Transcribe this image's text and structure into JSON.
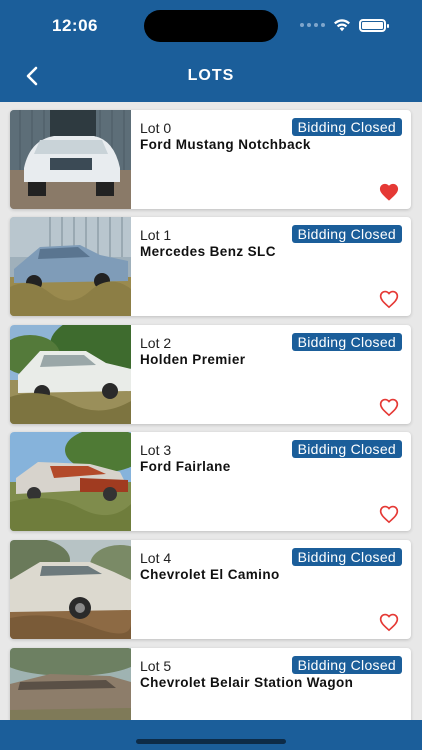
{
  "status_bar": {
    "time": "12:06"
  },
  "nav": {
    "title": "LOTS",
    "back_icon": "chevron-left-icon"
  },
  "colors": {
    "brand": "#1b5e9a",
    "favorite": "#e53935",
    "background": "#e8e8e8"
  },
  "lots": [
    {
      "lot": "Lot 0",
      "name": "Ford Mustang Notchback",
      "status": "Bidding Closed",
      "favorite": true,
      "photo": "car-photo-white-mustang-body"
    },
    {
      "lot": "Lot 1",
      "name": "Mercedes Benz SLC",
      "status": "Bidding Closed",
      "favorite": false,
      "photo": "car-photo-blue-mercedes"
    },
    {
      "lot": "Lot 2",
      "name": "Holden Premier",
      "status": "Bidding Closed",
      "favorite": false,
      "photo": "car-photo-white-holden"
    },
    {
      "lot": "Lot 3",
      "name": "Ford Fairlane",
      "status": "Bidding Closed",
      "favorite": false,
      "photo": "car-photo-rusty-fairlane"
    },
    {
      "lot": "Lot 4",
      "name": "Chevrolet El Camino",
      "status": "Bidding Closed",
      "favorite": false,
      "photo": "car-photo-el-camino"
    },
    {
      "lot": "Lot 5",
      "name": "Chevrolet Belair Station Wagon",
      "status": "Bidding Closed",
      "favorite": false,
      "photo": "car-photo-belair-wagon"
    }
  ]
}
